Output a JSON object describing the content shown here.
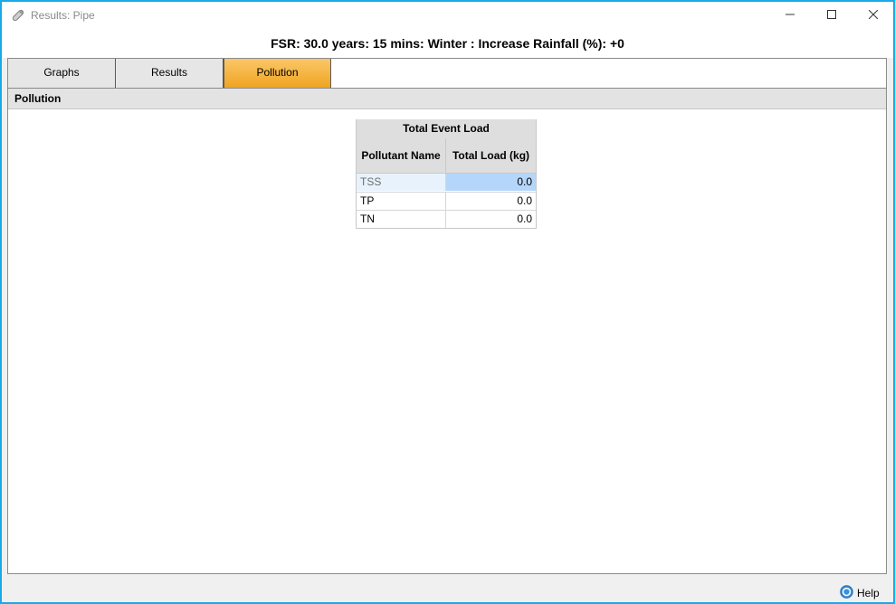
{
  "window": {
    "title": "Results: Pipe"
  },
  "header": {
    "summary": "FSR: 30.0 years: 15 mins: Winter : Increase Rainfall (%): +0"
  },
  "tabs": [
    {
      "label": "Graphs",
      "active": false
    },
    {
      "label": "Results",
      "active": false
    },
    {
      "label": "Pollution",
      "active": true
    }
  ],
  "section": {
    "title": "Pollution"
  },
  "table": {
    "group_header": "Total Event Load",
    "columns": [
      "Pollutant Name",
      "Total Load (kg)"
    ],
    "rows": [
      {
        "name": "TSS",
        "value": "0.0"
      },
      {
        "name": "TP",
        "value": "0.0"
      },
      {
        "name": "TN",
        "value": "0.0"
      }
    ]
  },
  "footer": {
    "help_label": "Help"
  },
  "colors": {
    "window_border": "#18a9e8",
    "active_tab": "#f5b23f",
    "selected_cell": "#b5d6fb"
  }
}
